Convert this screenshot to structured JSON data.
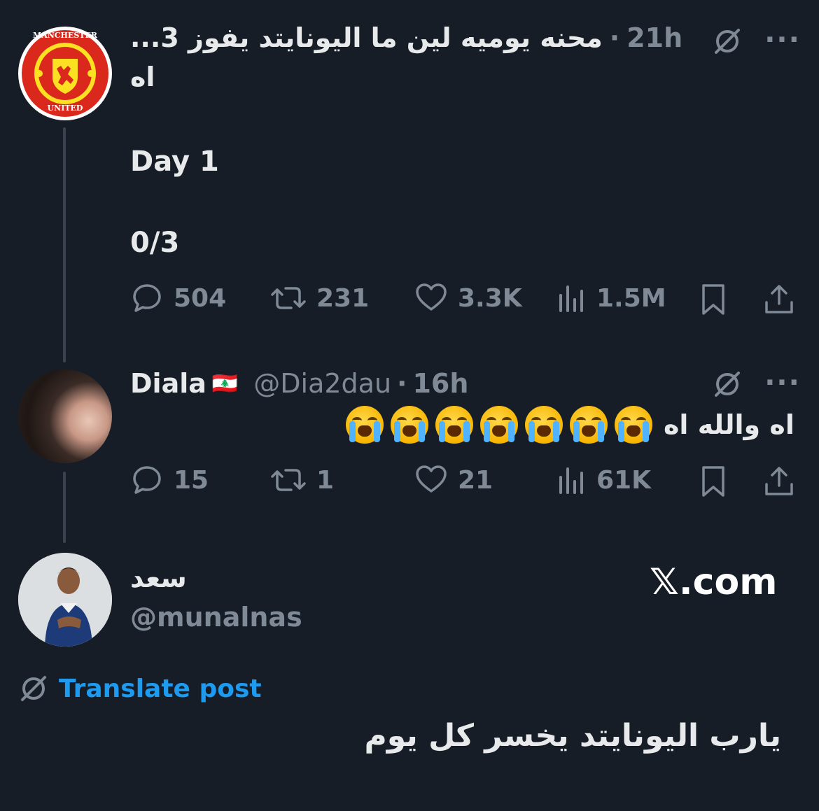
{
  "post1": {
    "title_line": "محنه يوميه لين ما اليونايتد يفوز 3...",
    "time": "21h",
    "line2": "اه",
    "body_day": "Day 1",
    "body_score": "0/3",
    "actions": {
      "replies": "504",
      "reposts": "231",
      "likes": "3.3K",
      "views": "1.5M"
    },
    "avatar_alt": "Manchester United crest",
    "crest_top": "MANCHESTER",
    "crest_bottom": "UNITED"
  },
  "post2": {
    "name": "Diala",
    "flag": "🇱🇧",
    "handle": "@Dia2dau",
    "time": "16h",
    "text": "اه والله اه",
    "emoji_count": 7,
    "actions": {
      "replies": "15",
      "reposts": "1",
      "likes": "21",
      "views": "61K"
    }
  },
  "post3": {
    "name": "سعد",
    "handle": "@munalnas",
    "brand": "𝕏.com",
    "translate": "Translate post",
    "text": "يارب اليونايتد يخسر كل يوم"
  },
  "colors": {
    "background": "#161d27",
    "muted": "#7f8a96",
    "link": "#1d9bf0",
    "thread_line": "#39424e"
  },
  "icons": [
    "grok-icon",
    "more-icon",
    "reply-icon",
    "repost-icon",
    "like-icon",
    "views-icon",
    "bookmark-icon",
    "share-icon",
    "emoji-loudly-crying-icon"
  ]
}
